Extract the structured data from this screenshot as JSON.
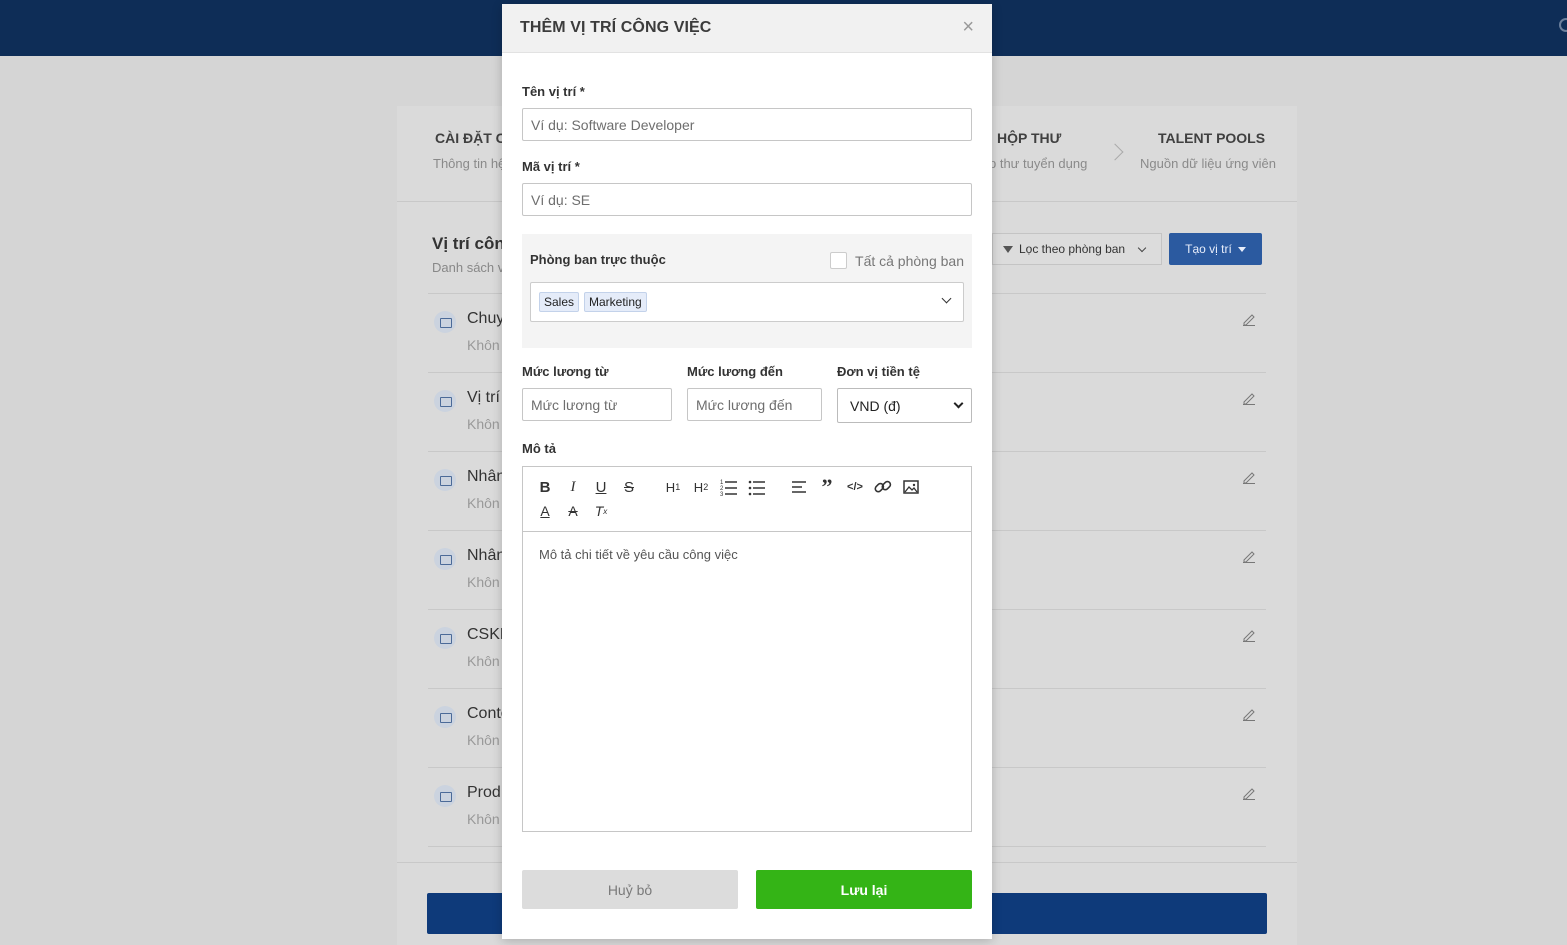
{
  "background": {
    "steps": [
      {
        "title": "CÀI ĐẶT C",
        "sub": "Thông tin hệ"
      },
      {
        "title": "HỘP THƯ",
        "sub": "p thư tuyển dụng"
      },
      {
        "title": "TALENT POOLS",
        "sub": "Nguồn dữ liệu ứng viên"
      }
    ],
    "heading": "Vị trí côn",
    "heading_sub": "Danh sách v",
    "filter_label": "Lọc theo phòng ban",
    "create_label": "Tạo vị trí",
    "rows": [
      {
        "title": "Chuy",
        "sub": "Khôn"
      },
      {
        "title": "Vị trí",
        "sub": "Khôn"
      },
      {
        "title": "Nhân",
        "sub": "Khôn"
      },
      {
        "title": "Nhân",
        "sub": "Khôn"
      },
      {
        "title": "CSKH",
        "sub": "Khôn"
      },
      {
        "title": "Conte",
        "sub": "Khôn"
      },
      {
        "title": "Prod",
        "sub": "Khôn"
      }
    ]
  },
  "modal": {
    "title": "THÊM VỊ TRÍ CÔNG VIỆC",
    "close": "×",
    "name_label": "Tên vị trí *",
    "name_placeholder": "Ví dụ: Software Developer",
    "code_label": "Mã vị trí *",
    "code_placeholder": "Ví dụ: SE",
    "dept_label": "Phòng ban trực thuộc",
    "all_dept_label": "Tất cả phòng ban",
    "dept_tags": [
      "Sales",
      "Marketing"
    ],
    "salary_from_label": "Mức lương từ",
    "salary_from_placeholder": "Mức lương từ",
    "salary_to_label": "Mức lương đến",
    "salary_to_placeholder": "Mức lương đến",
    "currency_label": "Đơn vị tiền tệ",
    "currency_value": "VND (đ)",
    "desc_label": "Mô tả",
    "desc_placeholder": "Mô tả chi tiết về yêu cầu công việc",
    "cancel_label": "Huỷ bỏ",
    "save_label": "Lưu lại"
  },
  "colors": {
    "topbar": "#0e2d57",
    "save": "#34b416",
    "create": "#2b5aa0"
  }
}
